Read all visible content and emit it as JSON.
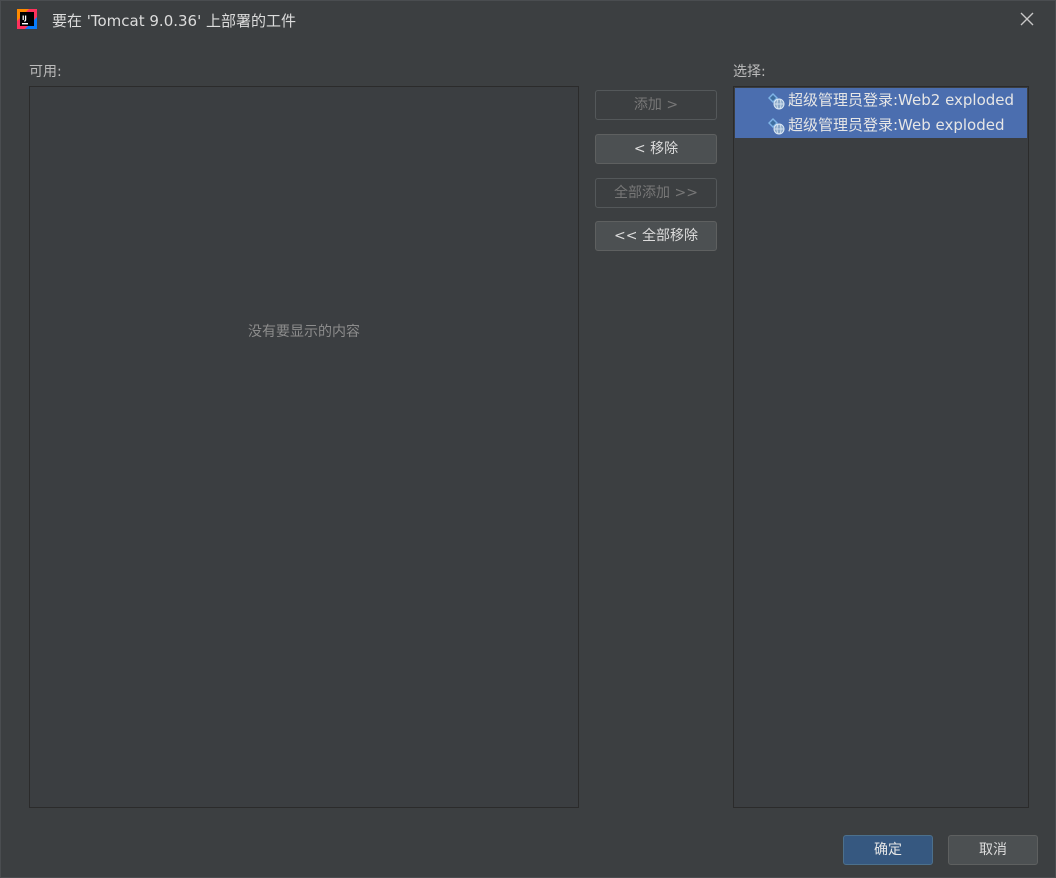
{
  "window": {
    "title": "要在 'Tomcat 9.0.36' 上部署的工件",
    "app_icon": "intellij-idea-icon",
    "close_icon": "close-icon"
  },
  "available": {
    "label": "可用:",
    "empty_text": "没有要显示的内容"
  },
  "selected": {
    "label": "选择:",
    "items": [
      {
        "label": "超级管理员登录:Web2 exploded",
        "icon": "web-artifact-icon"
      },
      {
        "label": "超级管理员登录:Web exploded",
        "icon": "web-artifact-icon"
      }
    ]
  },
  "actions": {
    "add": "添加 >",
    "remove": "< 移除",
    "add_all": "全部添加 >>",
    "remove_all": "<< 全部移除"
  },
  "footer": {
    "ok": "确定",
    "cancel": "取消"
  },
  "colors": {
    "background": "#3c3f41",
    "selection": "#4b6eaf",
    "primary_button": "#365880"
  }
}
